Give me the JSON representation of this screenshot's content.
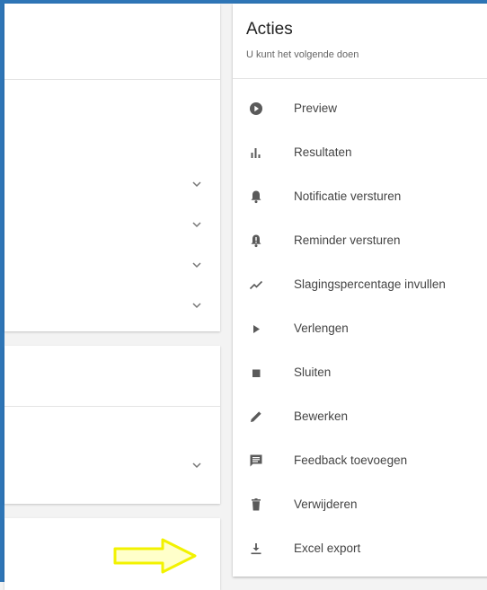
{
  "panel": {
    "title": "Acties",
    "subtitle": "U kunt het volgende doen"
  },
  "actions": [
    {
      "label": "Preview",
      "icon": "play-circle-icon"
    },
    {
      "label": "Resultaten",
      "icon": "bar-chart-icon"
    },
    {
      "label": "Notificatie versturen",
      "icon": "bell-icon"
    },
    {
      "label": "Reminder versturen",
      "icon": "bell-alert-icon"
    },
    {
      "label": "Slagingspercentage invullen",
      "icon": "trending-line-icon"
    },
    {
      "label": "Verlengen",
      "icon": "play-icon"
    },
    {
      "label": "Sluiten",
      "icon": "stop-icon"
    },
    {
      "label": "Bewerken",
      "icon": "pencil-icon"
    },
    {
      "label": "Feedback toevoegen",
      "icon": "comment-icon"
    },
    {
      "label": "Verwijderen",
      "icon": "trash-icon"
    },
    {
      "label": "Excel export",
      "icon": "download-icon"
    }
  ],
  "colors": {
    "frame": "#2e75b6",
    "annotation_arrow": "#f5f500",
    "icon": "#5a5a5a"
  }
}
